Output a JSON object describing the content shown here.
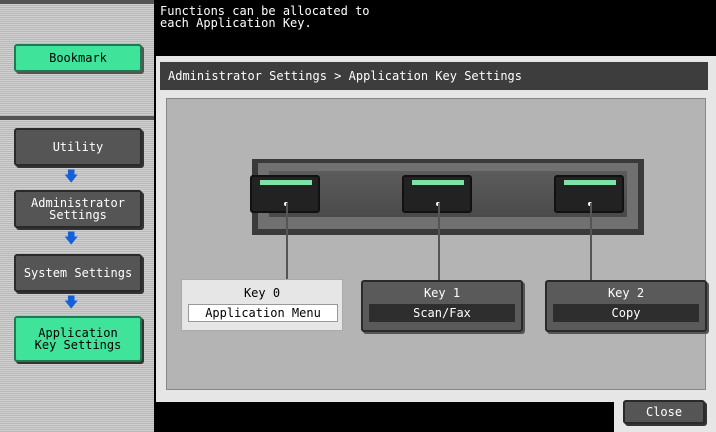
{
  "header": {
    "message": "Functions can be allocated to\neach Application Key."
  },
  "sidebar": {
    "bookmark_label": "Bookmark",
    "items": [
      {
        "label": "Utility"
      },
      {
        "label": "Administrator\nSettings"
      },
      {
        "label": "System Settings"
      },
      {
        "label": "Application\nKey Settings"
      }
    ]
  },
  "main": {
    "breadcrumb": "Administrator Settings > Application Key Settings",
    "keys": [
      {
        "title": "Key 0",
        "value": "Application Menu"
      },
      {
        "title": "Key 1",
        "value": "Scan/Fax"
      },
      {
        "title": "Key 2",
        "value": "Copy"
      }
    ]
  },
  "footer": {
    "close_label": "Close"
  },
  "colors": {
    "accent_green": "#3fe39a",
    "arrow_blue": "#1560d8",
    "button_gray": "#555555"
  },
  "icons": [
    "down-arrow-icon"
  ]
}
